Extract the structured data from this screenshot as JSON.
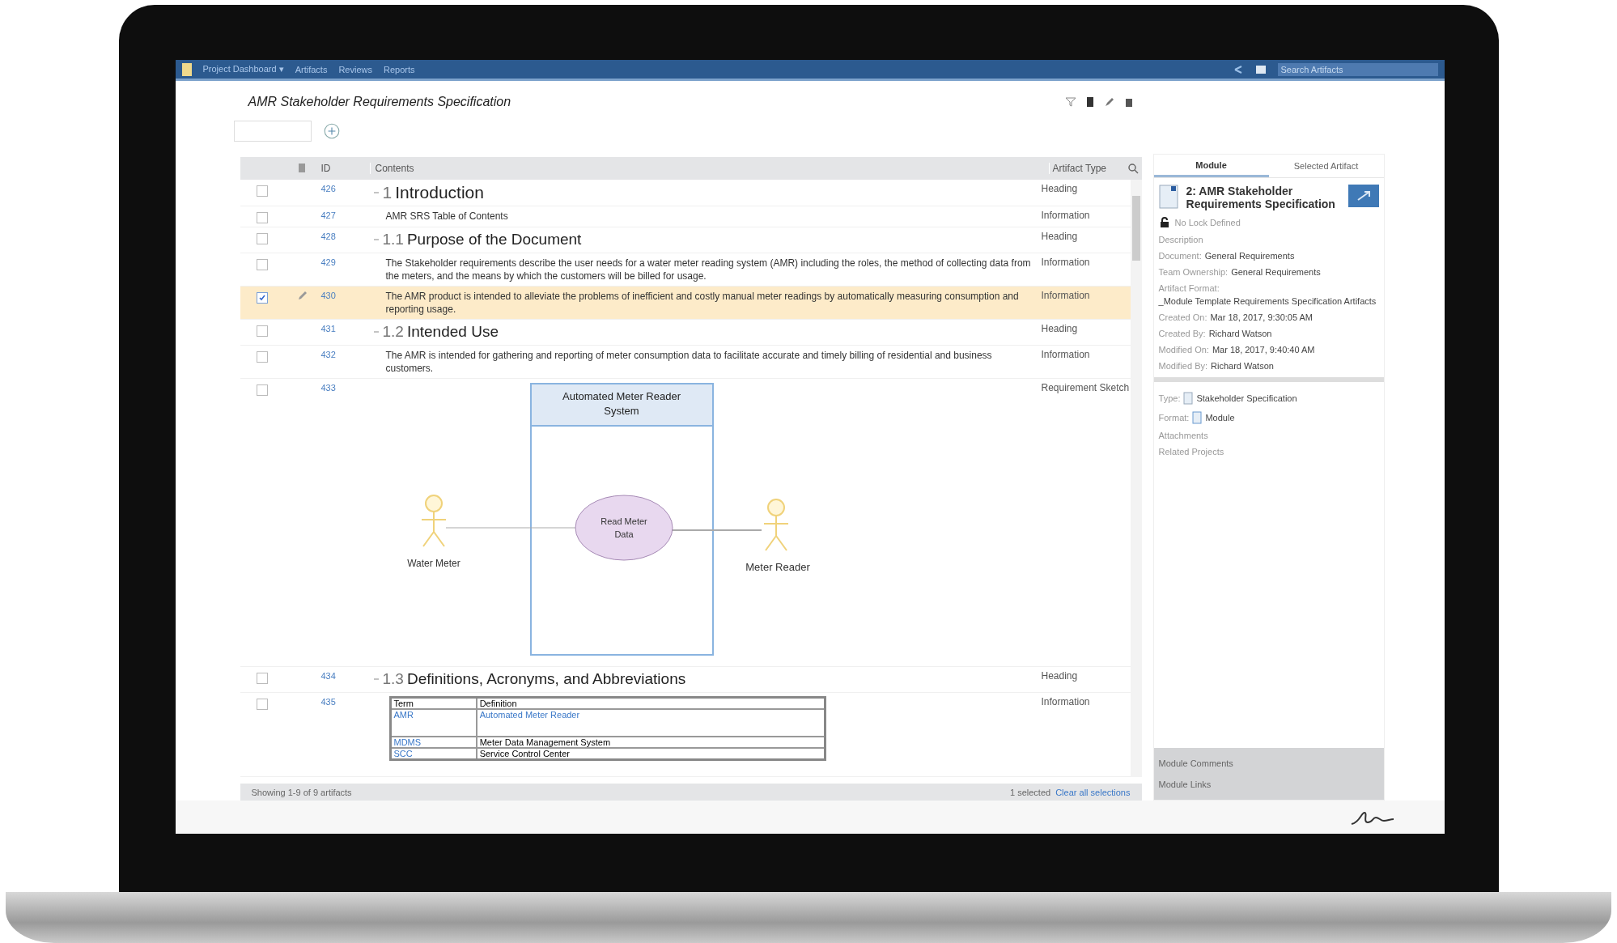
{
  "top_bar": {
    "menu": [
      "Project Dashboard ▾",
      "Artifacts",
      "Reviews",
      "Reports"
    ],
    "search": {
      "placeholder": "Search Artifacts"
    }
  },
  "module": {
    "title": "AMR Stakeholder Requirements Specification"
  },
  "table": {
    "columns": [
      "ID",
      "Contents",
      "Artifact Type"
    ],
    "rows": [
      {
        "kind": "heading",
        "id": "426",
        "number": "1",
        "title": "Introduction",
        "expanded": true,
        "type": "Heading",
        "selected": false
      },
      {
        "kind": "text",
        "id": "427",
        "text": "AMR SRS Table of Contents",
        "type": "Information",
        "selected": false
      },
      {
        "kind": "subheading",
        "id": "428",
        "number": "1.1",
        "title": "Purpose of the Document",
        "expanded": true,
        "type": "Heading",
        "selected": false
      },
      {
        "kind": "text",
        "id": "429",
        "text": "The Stakeholder requirements describe the user needs for a water meter reading system (AMR) including the roles, the method of collecting data from the meters, and the means by which the customers will be billed for usage.",
        "type": "Information",
        "selected": false
      },
      {
        "kind": "text",
        "id": "430",
        "text": "The AMR product is intended to alleviate the problems of inefficient and costly manual meter readings by automatically measuring consumption and reporting usage.",
        "type": "Information",
        "selected": true
      },
      {
        "kind": "subheading",
        "id": "431",
        "number": "1.2",
        "title": "Intended Use",
        "expanded": true,
        "type": "Heading",
        "selected": false
      },
      {
        "kind": "text",
        "id": "432",
        "text": "The AMR is intended for gathering and reporting of meter consumption data to facilitate accurate and timely billing of residential and business customers.",
        "type": "Information",
        "selected": false
      },
      {
        "kind": "diagram",
        "id": "433",
        "system": "Automated Meter Reader System",
        "use_case": "Read Meter Data",
        "actors": [
          "Water Meter",
          "Meter Reader"
        ],
        "type": "Requirement Sketch",
        "selected": false
      },
      {
        "kind": "subheading",
        "id": "434",
        "number": "1.3",
        "title": "Definitions, Acronyms, and Abbreviations",
        "expanded": true,
        "type": "Heading",
        "selected": false
      },
      {
        "kind": "table",
        "id": "435",
        "header": [
          "Term",
          "Definition"
        ],
        "cells": [
          [
            "AMR",
            "Automated Meter Reader"
          ],
          [
            "MDMS",
            "Meter Data Management System"
          ],
          [
            "SCC",
            "Service Control Center"
          ]
        ],
        "type": "Information",
        "selected": false
      }
    ]
  },
  "status_bar": {
    "count": "Showing 1-9 of 9 artifacts",
    "selection": "1 selected",
    "link": "Clear all selections"
  },
  "panel": {
    "tabs": [
      {
        "label": "Module",
        "selected": true
      },
      {
        "label": "Selected Artifact",
        "selected": false
      }
    ],
    "title": "2: AMR Stakeholder Requirements Specification",
    "lock": "No Lock Defined",
    "description": "Description",
    "fields": [
      {
        "label": "Document:",
        "value": "General Requirements"
      },
      {
        "label": "Team Ownership:",
        "value": "General Requirements"
      },
      {
        "label": "Artifact Format:",
        "value": "_Module Template Requirements Specification Artifacts"
      },
      {
        "label": "Created On:",
        "value": "Mar 18, 2017, 9:30:05 AM"
      },
      {
        "label": "Created By:",
        "value": "Richard Watson"
      },
      {
        "label": "Modified On:",
        "value": "Mar 18, 2017, 9:40:40 AM"
      },
      {
        "label": "Modified By:",
        "value": "Richard Watson"
      }
    ],
    "type_label": "Type:",
    "type_value": "Stakeholder Specification",
    "format_label": "Format:",
    "format_value": "Module",
    "extra": [
      "Attachments",
      "Related Projects"
    ],
    "sections": [
      "Module Comments",
      "Module Links"
    ]
  }
}
